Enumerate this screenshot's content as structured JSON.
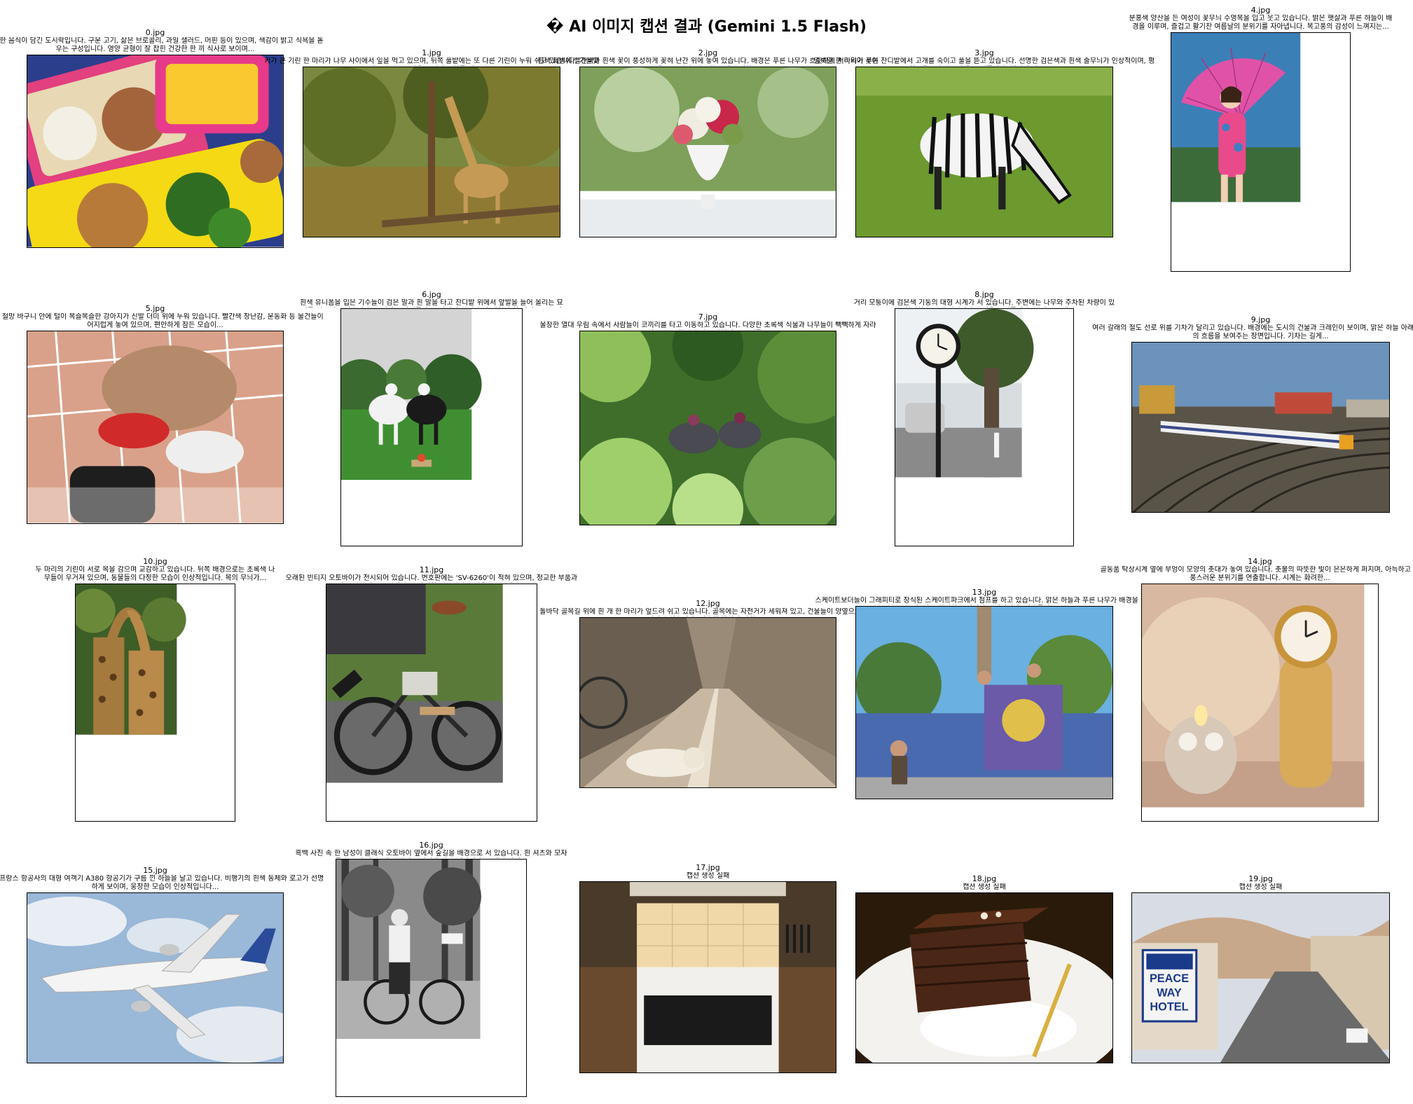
{
  "title": "� AI 이미지 캡션 결과 (Gemini 1.5 Flash)",
  "images": [
    {
      "file": "0.jpg",
      "caption": "다양한 음식이 담긴 도시락입니다. 구운 고기, 삶은 브로콜리, 과일 샐러드, 머핀 등이 있으며, 색감이 밝고 식욕을 돋우는 구성입니다. 영양 균형이 잘 잡힌 건강한 한 끼 식사로 보이며...",
      "scene": "lunchbox"
    },
    {
      "file": "1.jpg",
      "caption": "키가 큰 기린 한 마리가 나무 사이에서 잎을 먹고 있으며, 뒤쪽 풀밭에는 또 다른 기린이 누워 쉬고 있습니다. 가을빛 나무와 자연스러운 풍경이 조화를 이루며...",
      "scene": "giraffe"
    },
    {
      "file": "2.jpg",
      "caption": "흰색 화병에 빨간색과 흰색 꽃이 풍성하게 꽂혀 난간 위에 놓여 있습니다. 배경은 푸른 나무가 흐릿하게 처리되어 꽃이 더욱 돋보이며, 따뜻한 햇살이 비치는...",
      "scene": "vase"
    },
    {
      "file": "3.jpg",
      "caption": "얼룩말 한 마리가 푸른 잔디밭에서 고개를 숙이고 풀을 뜯고 있습니다. 선명한 검은색과 흰색 줄무늬가 인상적이며, 평화로운 오후의 모습을 보여줍니다. 햇살이 잘 드는...",
      "scene": "zebra"
    },
    {
      "file": "4.jpg",
      "caption": "분홍색 양산을 든 여성이 꽃무늬 수영복을 입고 웃고 있습니다. 밝은 햇살과 푸른 하늘이 배경을 이루며, 즐겁고 활기찬 여름날의 분위기를 자아냅니다. 복고풍의 감성이 느껴지는...",
      "scene": "umbrella"
    },
    {
      "file": "5.jpg",
      "caption": "흰색 철망 바구니 안에 털이 복슬복슬한 강아지가 신발 더미 위에 누워 있습니다. 빨간색 장난감, 운동화 등 물건들이 어지럽게 놓여 있으며, 편안하게 잠든 모습이...",
      "scene": "dog"
    },
    {
      "file": "6.jpg",
      "caption": "흰색 유니폼을 입은 기수들이 검은 말과 흰 말을 타고 잔디밭 위에서 앞발을 들어 올리는 묘기를 선보이고 있습니다. 주변에는 장애물과 꽃 장식이 있어 승마 대회의 한 장면으로 보이며...",
      "scene": "horses"
    },
    {
      "file": "7.jpg",
      "caption": "울창한 열대 우림 속에서 사람들이 코끼리를 타고 이동하고 있습니다. 다양한 초록색 식물과 나무들이 빽빽하게 자라 있으며, 모험적인 정글 탐험의 분위기를...",
      "scene": "jungle"
    },
    {
      "file": "8.jpg",
      "caption": "거리 모퉁이에 검은색 기둥의 대형 시계가 서 있습니다. 주변에는 나무와 주차된 차량이 있으며, 한적한 도시의 일상적인 풍경을 보여줍니다. 시계는 오래된...",
      "scene": "clock"
    },
    {
      "file": "9.jpg",
      "caption": "여러 갈래의 철도 선로 위를 기차가 달리고 있습니다. 배경에는 도시의 건물과 크레인이 보이며, 맑은 하늘 아래 교통의 흐름을 보여주는 장면입니다. 기차는 길게...",
      "scene": "train"
    },
    {
      "file": "10.jpg",
      "caption": "두 마리의 기린이 서로 목을 감으며 교감하고 있습니다. 뒤쪽 배경으로는 초록색 나무들이 우거져 있으며, 동물들의 다정한 모습이 인상적입니다. 목의 무늬가...",
      "scene": "giraffes"
    },
    {
      "file": "11.jpg",
      "caption": "오래된 빈티지 오토바이가 전시되어 있습니다. 번호판에는 'SV-6260'이 적혀 있으며, 정교한 부품과 가죽 안장이 돋보입니다. 클래식한 디자인이 눈길을 끌며, 옆에...",
      "scene": "motorcycle"
    },
    {
      "file": "12.jpg",
      "caption": "돌바닥 골목길 위에 흰 개 한 마리가 엎드려 쉬고 있습니다. 골목에는 자전거가 세워져 있고, 건물들이 양옆으로 길게 이어져 있습니다. 따뜻한 햇살이 비치는...",
      "scene": "street"
    },
    {
      "file": "13.jpg",
      "caption": "스케이트보더들이 그래피티로 장식된 스케이트파크에서 점프를 하고 있습니다. 맑은 하늘과 푸른 나무가 배경을 이루며, 젊고 활기찬 분위기가 느껴집니다. 관중들이...",
      "scene": "skate"
    },
    {
      "file": "14.jpg",
      "caption": "골동품 탁상시계 옆에 부엉이 모양의 촛대가 놓여 있습니다. 촛불의 따뜻한 빛이 은은하게 퍼지며, 아늑하고 고풍스러운 분위기를 연출합니다. 시계는 화려한...",
      "scene": "antique"
    },
    {
      "file": "15.jpg",
      "caption": "에어프랑스 항공사의 대형 여객기 A380 항공기가 구름 낀 하늘을 날고 있습니다. 비행기의 흰색 동체와 로고가 선명하게 보이며, 웅장한 모습이 인상적입니다...",
      "scene": "plane"
    },
    {
      "file": "16.jpg",
      "caption": "흑백 사진 속 한 남성이 클래식 오토바이 옆에서 숲길을 배경으로 서 있습니다. 흰 셔츠와 모자를 쓴 모습이며, 옛 시절의 분위기가 잘 느껴집니다. 오래된 사진...",
      "scene": "bw"
    },
    {
      "file": "17.jpg",
      "caption": "캡션 생성 실패",
      "scene": "kitchen"
    },
    {
      "file": "18.jpg",
      "caption": "캡션 생성 실패",
      "scene": "cake"
    },
    {
      "file": "19.jpg",
      "caption": "캡션 생성 실패",
      "scene": "town",
      "sign_text": [
        "PEACE",
        "WAY",
        "HOTEL"
      ]
    }
  ],
  "sign_text": [
    "PEACE",
    "WAY",
    "HOTEL"
  ]
}
